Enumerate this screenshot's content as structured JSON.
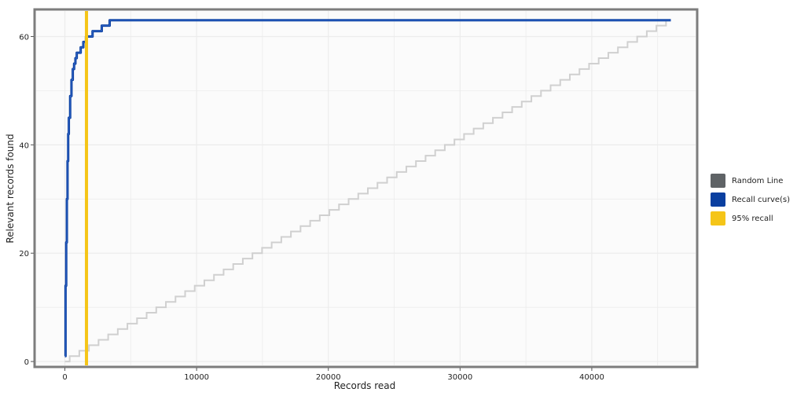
{
  "chart_data": {
    "type": "line",
    "title": "",
    "xlabel": "Records read",
    "ylabel": "Relevant records found",
    "xlim": [
      -2300,
      48000
    ],
    "ylim": [
      -1,
      65
    ],
    "x_ticks": [
      0,
      10000,
      20000,
      30000,
      40000
    ],
    "x_tick_labels": [
      "0",
      "10000",
      "20000",
      "30000",
      "40000"
    ],
    "y_ticks": [
      0,
      20,
      40,
      60
    ],
    "y_tick_labels": [
      "0",
      "20",
      "40",
      "60"
    ],
    "grid": true,
    "legend_position": "right",
    "series": [
      {
        "name": "Random Line",
        "color": "#5f6366",
        "x": [
          0,
          46000
        ],
        "y": [
          0,
          63
        ]
      },
      {
        "name": "Recall curve(s)",
        "color": "#0a3fa0",
        "x": [
          0,
          50,
          100,
          150,
          200,
          250,
          300,
          400,
          500,
          600,
          700,
          800,
          900,
          1000,
          1100,
          1200,
          1300,
          1400,
          1500,
          1600,
          1700,
          1900,
          2100,
          2300,
          2600,
          2800,
          3000,
          3200,
          3400,
          3600,
          3800,
          4000,
          46000
        ],
        "y": [
          1,
          14,
          22,
          30,
          37,
          42,
          45,
          49,
          52,
          54,
          55,
          56,
          57,
          57,
          57,
          58,
          58,
          59,
          59,
          60,
          60,
          60,
          61,
          61,
          61,
          62,
          62,
          62,
          63,
          63,
          63,
          63,
          63
        ]
      },
      {
        "name": "95% recall",
        "color": "#f5c518",
        "x": [
          1640,
          1640
        ],
        "y": [
          -1,
          65
        ]
      }
    ]
  }
}
